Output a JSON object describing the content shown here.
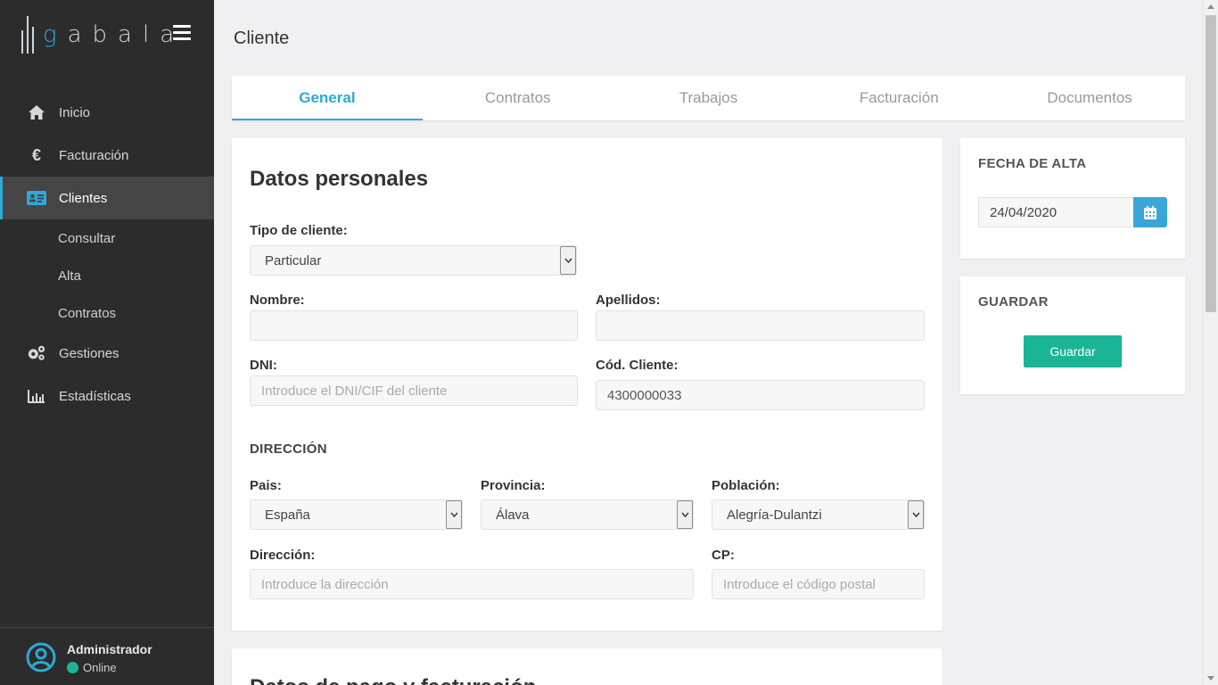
{
  "app": {
    "logo_text": "abala",
    "logo_g": "g"
  },
  "sidebar": {
    "items": [
      {
        "label": "Inicio",
        "icon": "home-icon"
      },
      {
        "label": "Facturación",
        "icon": "euro-icon"
      },
      {
        "label": "Clientes",
        "icon": "id-card-icon"
      },
      {
        "label": "Gestiones",
        "icon": "gears-icon"
      },
      {
        "label": "Estadísticas",
        "icon": "bar-chart-icon"
      }
    ],
    "sub_items": [
      "Consultar",
      "Alta",
      "Contratos"
    ],
    "user": {
      "name": "Administrador",
      "status": "Online"
    }
  },
  "page": {
    "title": "Cliente"
  },
  "tabs": [
    "General",
    "Contratos",
    "Trabajos",
    "Facturación",
    "Documentos"
  ],
  "form": {
    "section_title": "Datos personales",
    "tipo_label": "Tipo de cliente:",
    "tipo_value": "Particular",
    "nombre_label": "Nombre:",
    "nombre_value": "",
    "apellidos_label": "Apellidos:",
    "apellidos_value": "",
    "dni_label": "DNI:",
    "dni_placeholder": "Introduce el DNI/CIF del cliente",
    "cod_label": "Cód. Cliente:",
    "cod_value": "4300000033",
    "direccion_section": "DIRECCIÓN",
    "pais_label": "Pais:",
    "pais_value": "España",
    "provincia_label": "Provincia:",
    "provincia_value": "Álava",
    "poblacion_label": "Población:",
    "poblacion_value": "Alegría-Dulantzi",
    "direccion_label": "Dirección:",
    "direccion_placeholder": "Introduce la dirección",
    "cp_label": "CP:",
    "cp_placeholder": "Introduce el código postal",
    "next_section_title": "Datos de pago y facturación"
  },
  "fecha": {
    "title": "FECHA DE ALTA",
    "value": "24/04/2020"
  },
  "guardar": {
    "title": "GUARDAR",
    "button": "Guardar"
  },
  "colors": {
    "accent": "#2fa8d6",
    "save": "#19b596",
    "sidebar_bg": "#2c2c2c"
  }
}
